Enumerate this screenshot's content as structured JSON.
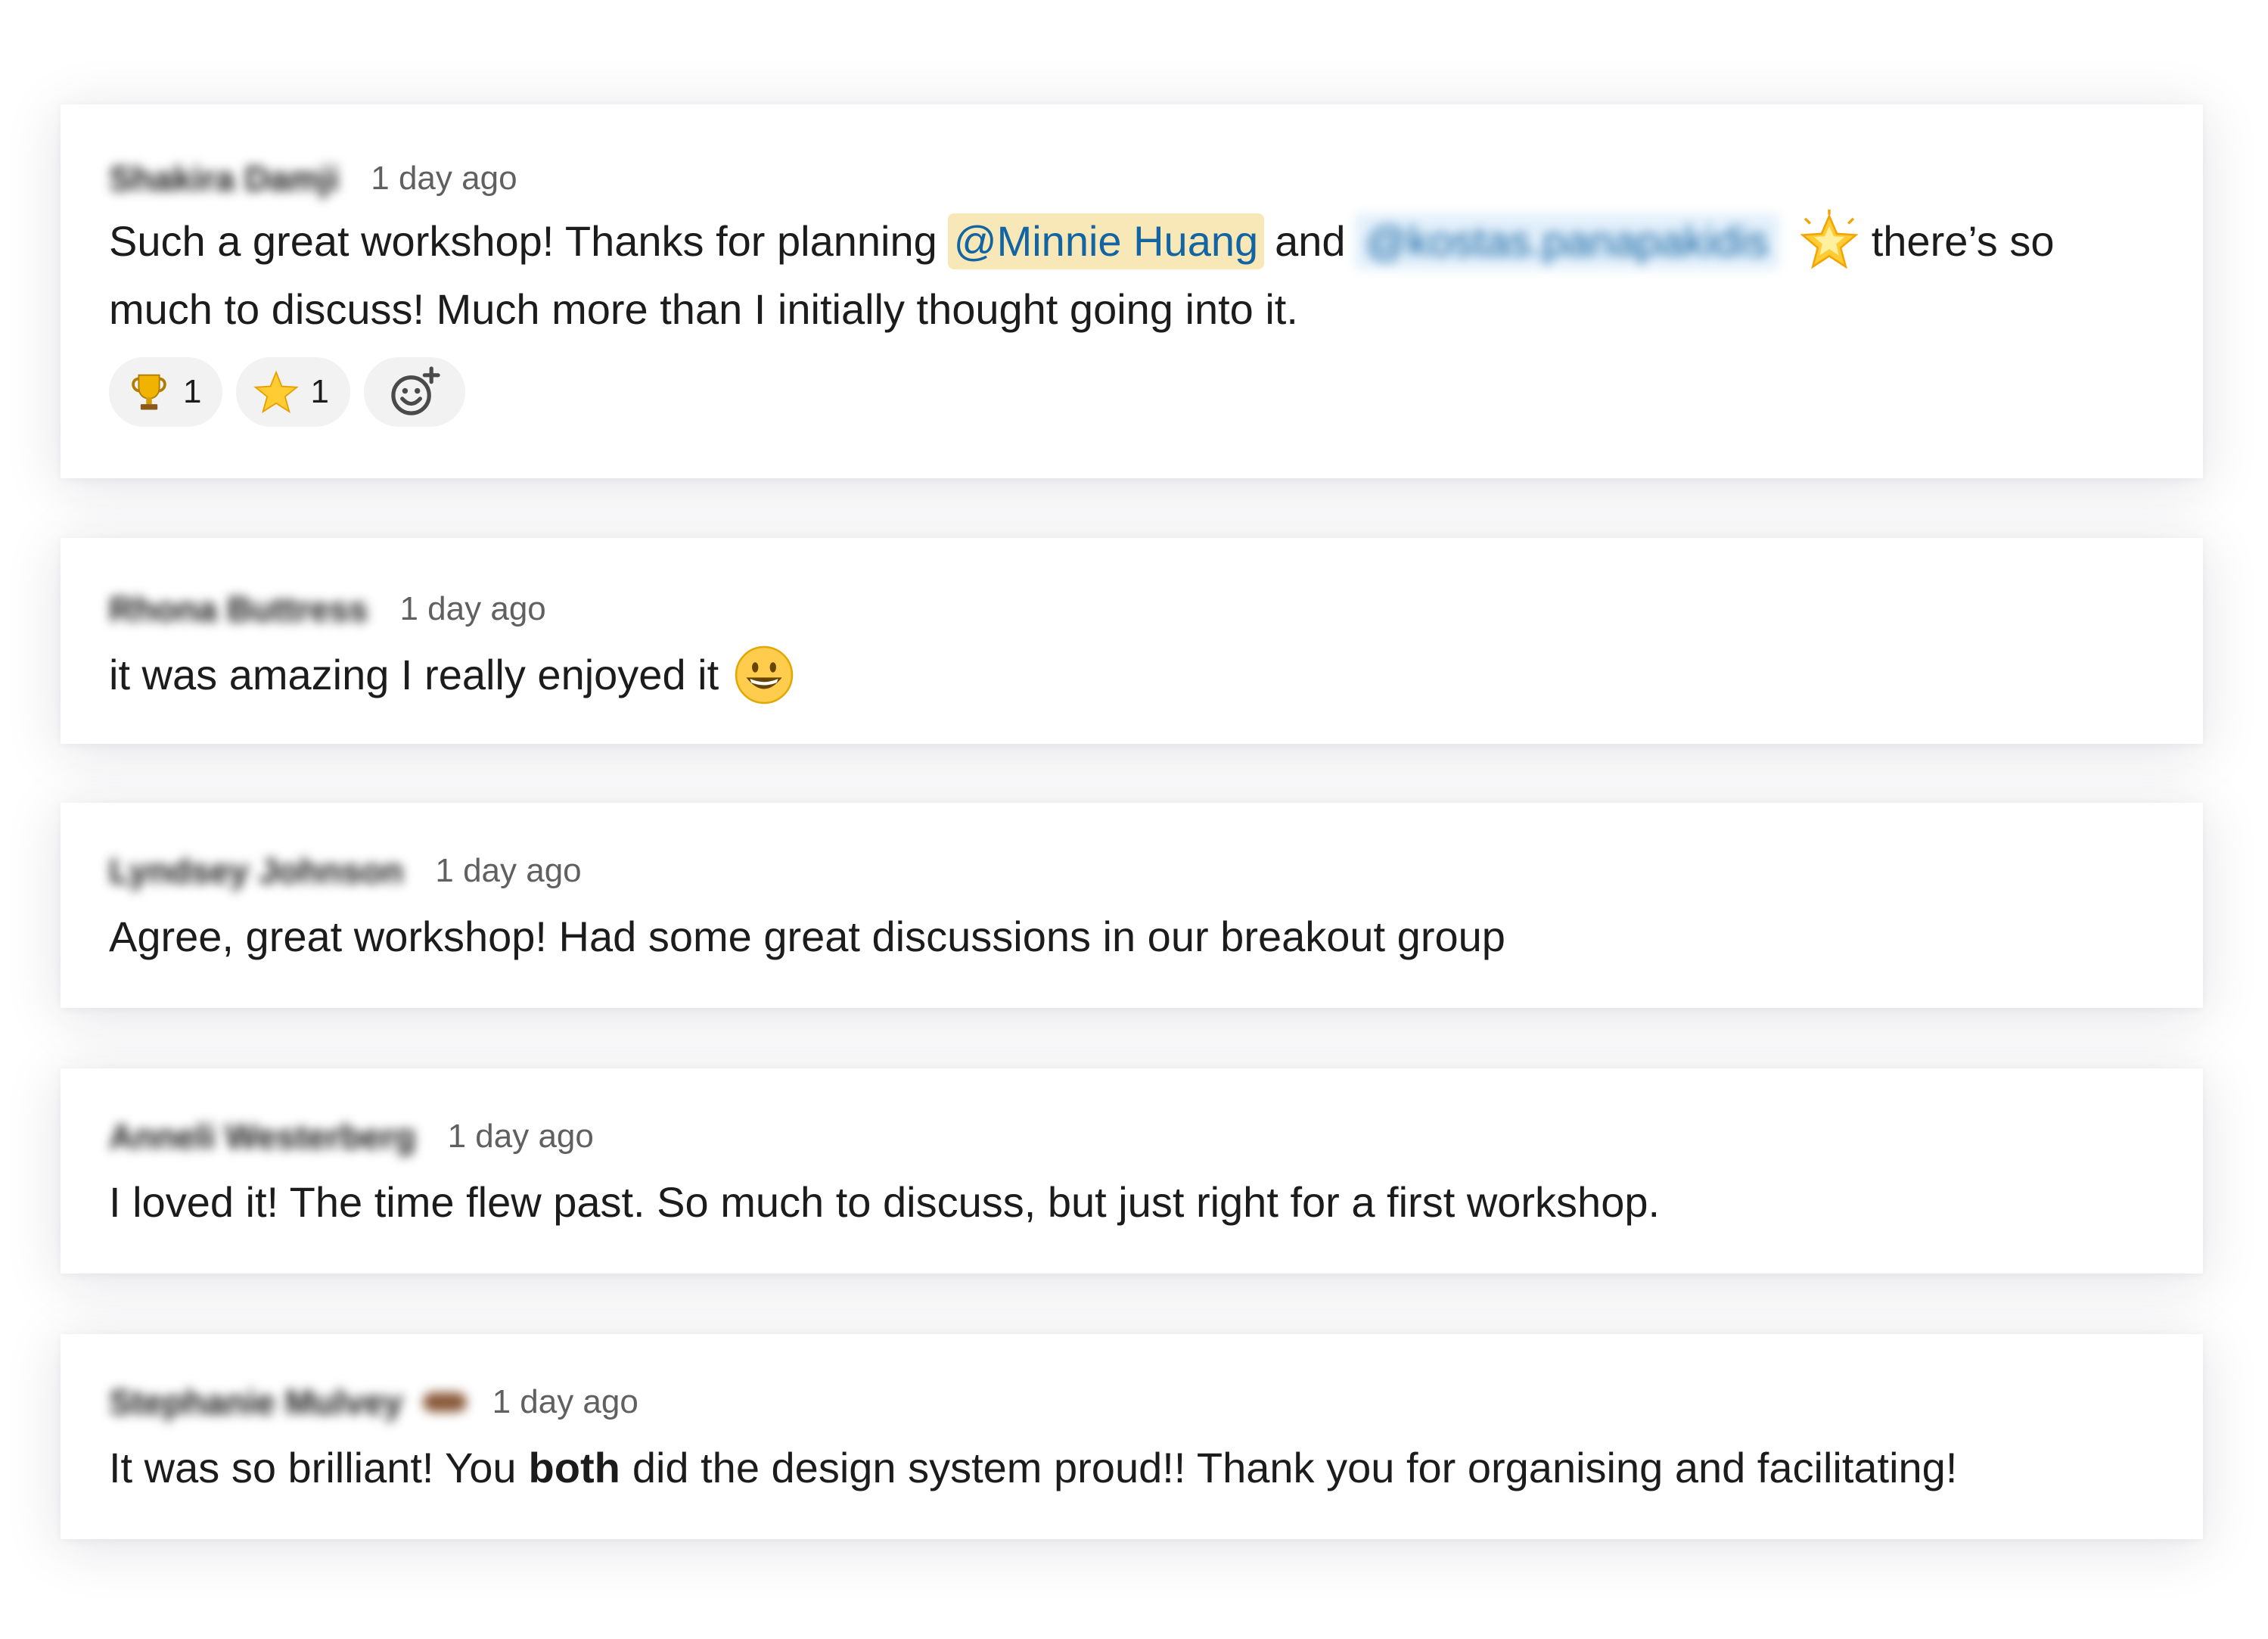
{
  "comments": [
    {
      "author": "Shakira Damji",
      "time": "1 day ago",
      "text_before_mention": "Such a great workshop! Thanks for planning",
      "mention_1": "@Minnie Huang",
      "text_between_mentions": "and",
      "mention_2": "@kostas.panapakidis",
      "inline_emoji": "glowing-star-icon",
      "text_after_emoji": "there’s so",
      "text_line_2": "much to discuss! Much more than I initially thought going into it.",
      "reactions": [
        {
          "icon": "trophy-icon",
          "count": "1"
        },
        {
          "icon": "star-icon",
          "count": "1"
        }
      ],
      "add_reaction_icon": "add-reaction-icon"
    },
    {
      "author": "Rhona Buttress",
      "time": "1 day ago",
      "text": "it was amazing I really enjoyed it",
      "inline_emoji": "grinning-face-icon"
    },
    {
      "author": "Lyndsey Johnson",
      "time": "1 day ago",
      "text": "Agree, great workshop! Had some great discussions in our breakout group"
    },
    {
      "author": "Anneli Westerberg",
      "time": "1 day ago",
      "text": "I loved it! The time flew past. So much to discuss, but just right for a first workshop."
    },
    {
      "author": "Stephanie Mulvey",
      "time": "1 day ago",
      "text_before_bold": "It was so brilliant! You",
      "text_bold": "both",
      "text_after_bold": "did the design system proud!! Thank you for organising and facilitating!"
    }
  ],
  "colors": {
    "mention_bg": "#f8e8b8",
    "mention_text": "#1264a3",
    "timestamp": "#616061",
    "reaction_bg": "#f2f2f2"
  }
}
